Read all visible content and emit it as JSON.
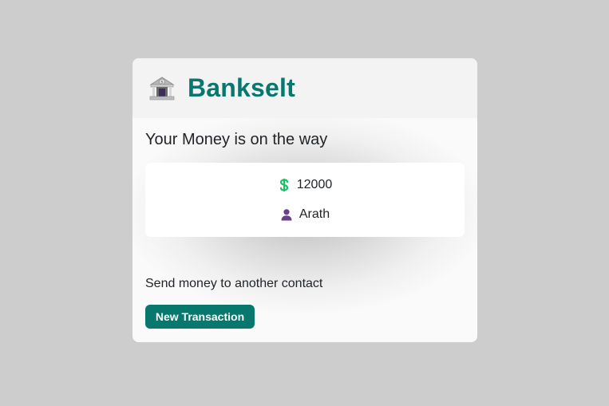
{
  "header": {
    "brand": "Bankselt",
    "icon": "bank-icon"
  },
  "main": {
    "headline": "Your Money is on the way",
    "summary": {
      "amount": "12000",
      "amount_icon": "dollar-icon",
      "recipient": "Arath",
      "recipient_icon": "user-icon"
    },
    "send_text": "Send money to another contact",
    "button_label": "New Transaction"
  },
  "colors": {
    "brand": "#08776d",
    "dollar_icon": "#1fbf6a",
    "user_icon": "#6a3f8a",
    "page_background": "#cdcdcd"
  }
}
